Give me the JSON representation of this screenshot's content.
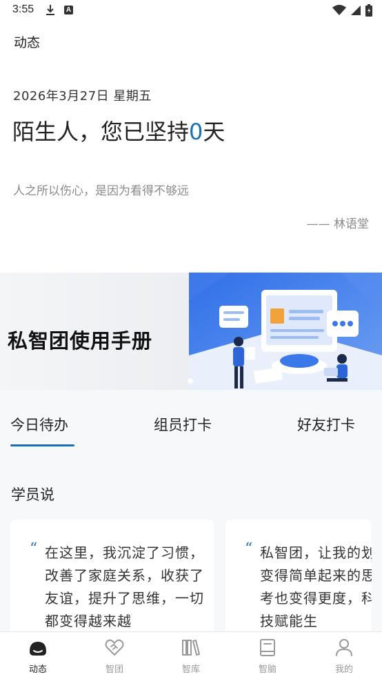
{
  "status_bar": {
    "time": "3:55",
    "a_badge": "A",
    "icons": [
      "download-icon",
      "a-badge-icon",
      "wifi-icon",
      "signal-icon",
      "battery-icon"
    ]
  },
  "header": {
    "title": "动态"
  },
  "summary": {
    "date": "2026年3月27日 星期五",
    "greeting_prefix": "陌生人，您已坚持",
    "days": "0",
    "greeting_suffix": "天"
  },
  "quote": {
    "text": "人之所以伤心，是因为看得不够远",
    "author": "—— 林语堂"
  },
  "banner": {
    "title": "私智团使用手册"
  },
  "tabs": [
    {
      "label": "今日待办",
      "active": true
    },
    {
      "label": "组员打卡",
      "active": false
    },
    {
      "label": "好友打卡",
      "active": false
    }
  ],
  "testimonials": {
    "title": "学员说",
    "quote_mark": "“",
    "cards": [
      {
        "text": "在这里，我沉淀了习惯，改善了家庭关系，收获了友谊，提升了思维，一切都变得越来越"
      },
      {
        "text": "私智团，让我的划变得简单起来的思考也变得更度，科技赋能生"
      }
    ]
  },
  "bottom_nav": [
    {
      "label": "动态",
      "icon": "moments-icon",
      "active": true
    },
    {
      "label": "智团",
      "icon": "handshake-heart-icon",
      "active": false
    },
    {
      "label": "智库",
      "icon": "bookshelf-icon",
      "active": false
    },
    {
      "label": "智脑",
      "icon": "notebook-icon",
      "active": false
    },
    {
      "label": "我的",
      "icon": "person-icon",
      "active": false
    }
  ],
  "colors": {
    "accent": "#1a6fb5",
    "muted_text": "#8a8a8a",
    "background": "#ffffff",
    "section_bg": "#f7f8fa"
  }
}
